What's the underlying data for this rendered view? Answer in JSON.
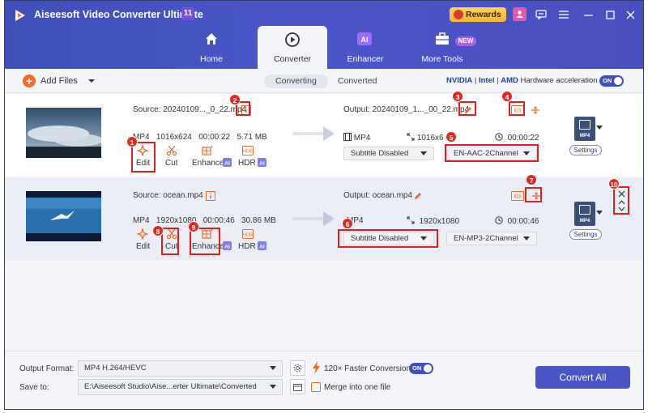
{
  "app": {
    "title": "Aiseesoft Video Converter Ultimate",
    "version_badge": "11",
    "rewards_label": "Rewards"
  },
  "nav": {
    "tabs": [
      {
        "label": "Home",
        "icon": "home-icon"
      },
      {
        "label": "Converter",
        "icon": "converter-icon",
        "active": true
      },
      {
        "label": "Enhancer",
        "icon": "ai-enhancer-icon"
      },
      {
        "label": "More Tools",
        "icon": "toolbox-icon",
        "badge": "NEW"
      }
    ]
  },
  "toolbar": {
    "add_files": "Add Files",
    "segments": [
      "Converting",
      "Converted"
    ],
    "active_segment": "Converting",
    "hw_nvidia": "NVIDIA",
    "hw_intel": "Intel",
    "hw_amd": "AMD",
    "hw_label": "Hardware acceleration",
    "hw_toggle": "ON"
  },
  "files": [
    {
      "source_label": "Source: 20240109..._0_22.mp4",
      "format": "MP4",
      "resolution": "1016x624",
      "duration": "00:00:22",
      "size": "5.71 MB",
      "output_label": "Output: 20240109_1..._00_22.mp4",
      "out_format": "MP4",
      "out_resolution": "1016x6",
      "out_duration": "00:00:22",
      "subtitle": "Subtitle Disabled",
      "audio": "EN-AAC-2Channel",
      "tools": [
        "Edit",
        "Cut",
        "Enhance",
        "HDR"
      ],
      "format_box": "MP4",
      "settings": "Settings"
    },
    {
      "source_label": "Source: ocean.mp4",
      "format": "MP4",
      "resolution": "1920x1080",
      "duration": "00:00:46",
      "size": "30.86 MB",
      "output_label": "Output: ocean.mp4",
      "out_format": "MP4",
      "out_resolution": "1920x1080",
      "out_duration": "00:00:46",
      "subtitle": "Subtitle Disabled",
      "audio": "EN-MP3-2Channel",
      "tools": [
        "Edit",
        "Cut",
        "Enhance",
        "HDR"
      ],
      "format_box": "MP4",
      "settings": "Settings"
    }
  ],
  "annotations": [
    "1",
    "2",
    "3",
    "4",
    "5",
    "6",
    "7",
    "8",
    "9",
    "10"
  ],
  "bottom": {
    "output_format_label": "Output Format:",
    "output_format_value": "MP4 H.264/HEVC",
    "save_to_label": "Save to:",
    "save_to_value": "E:\\Aiseesoft Studio\\Aise...erter Ultimate\\Converted",
    "faster_label": "120× Faster Conversion",
    "faster_toggle": "ON",
    "merge_label": "Merge into one file",
    "convert_all": "Convert All"
  },
  "colors": {
    "header": "#4a56c8",
    "accent_orange": "#f26a2a",
    "annotation_red": "#e02020",
    "convert_button": "#4a56c8"
  }
}
